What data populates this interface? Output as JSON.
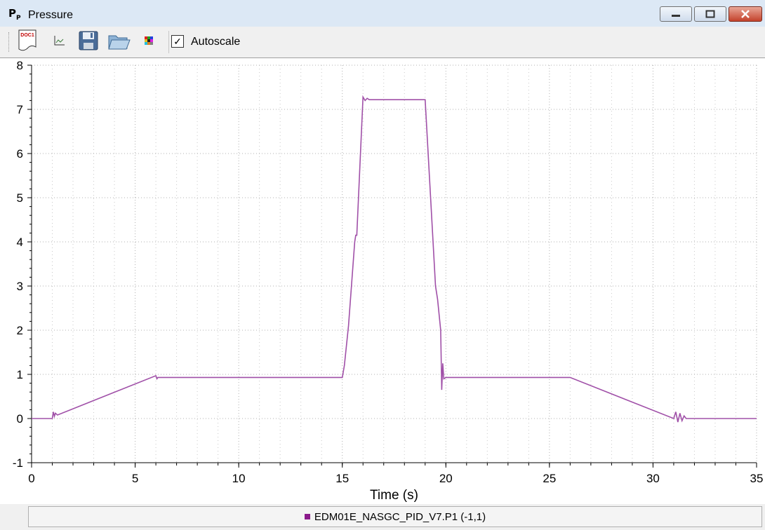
{
  "window": {
    "title": "Pressure",
    "icon_text": "P",
    "icon_sub": "P",
    "controls": {
      "minimize": "minimize-icon",
      "maximize": "maximize-icon",
      "close": "close-icon"
    }
  },
  "toolbar": {
    "buttons": [
      "document-icon",
      "plot-icon",
      "save-icon",
      "open-folder-icon",
      "color-palette-icon"
    ],
    "document_icon_text": "DOC1",
    "autoscale_label": "Autoscale",
    "autoscale_checked": true,
    "checkmark": "✓"
  },
  "legend": {
    "entry": "EDM01E_NASGC_PID_V7.P1 (-1,1)",
    "color": "#8b1a8b"
  },
  "chart_data": {
    "type": "line",
    "xlabel": "Time (s)",
    "ylabel": "",
    "xlim": [
      0,
      35
    ],
    "ylim": [
      -1,
      8
    ],
    "xticks": [
      0,
      5,
      10,
      15,
      20,
      25,
      30,
      35
    ],
    "yticks": [
      -1,
      0,
      1,
      2,
      3,
      4,
      5,
      6,
      7,
      8
    ],
    "grid": true,
    "line_color": "#a050a8",
    "series": [
      {
        "name": "EDM01E_NASGC_PID_V7.P1 (-1,1)",
        "x": [
          0,
          1.0,
          1.05,
          1.1,
          1.15,
          1.25,
          6.0,
          6.05,
          6.1,
          15.0,
          15.1,
          15.3,
          15.6,
          15.65,
          15.7,
          16.0,
          16.1,
          16.2,
          16.3,
          19.0,
          19.5,
          19.6,
          19.75,
          19.8,
          19.85,
          19.9,
          20.0,
          26.0,
          31.0,
          31.1,
          31.2,
          31.3,
          31.4,
          31.5,
          31.6,
          32.0,
          35.0
        ],
        "y": [
          0,
          0,
          0.15,
          0.05,
          0.12,
          0.08,
          0.97,
          0.9,
          0.93,
          0.93,
          1.2,
          2.1,
          4.0,
          4.15,
          4.15,
          7.28,
          7.2,
          7.25,
          7.22,
          7.22,
          3.0,
          2.7,
          2.0,
          0.65,
          1.25,
          0.9,
          0.93,
          0.93,
          0.0,
          0.15,
          -0.08,
          0.12,
          -0.05,
          0.06,
          0.0,
          0.0,
          0.0
        ]
      }
    ]
  }
}
